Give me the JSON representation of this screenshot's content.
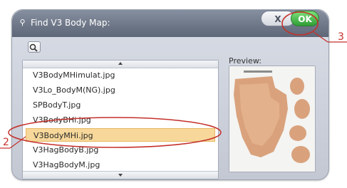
{
  "dialog": {
    "title": "Find V3 Body Map:",
    "close_label": "X",
    "ok_label": "OK",
    "preview_label": "Preview:"
  },
  "file_list": {
    "items": [
      {
        "label": "V3BodyMHimulat.jpg",
        "selected": false
      },
      {
        "label": "V3Lo_BodyM(NG).jpg",
        "selected": false
      },
      {
        "label": "SPBodyT.jpg",
        "selected": false
      },
      {
        "label": "V3BodyBHi.jpg",
        "selected": false
      },
      {
        "label": "V3BodyMHi.jpg",
        "selected": true
      },
      {
        "label": "V3HagBodyB.jpg",
        "selected": false
      },
      {
        "label": "V3HagBodyM.jpg",
        "selected": false
      }
    ]
  },
  "annotations": {
    "callout_2": "2",
    "callout_3": "3"
  },
  "colors": {
    "selection_fill": "#f7d89a",
    "callout_red": "#c4302b",
    "ok_green": "#3db142"
  }
}
